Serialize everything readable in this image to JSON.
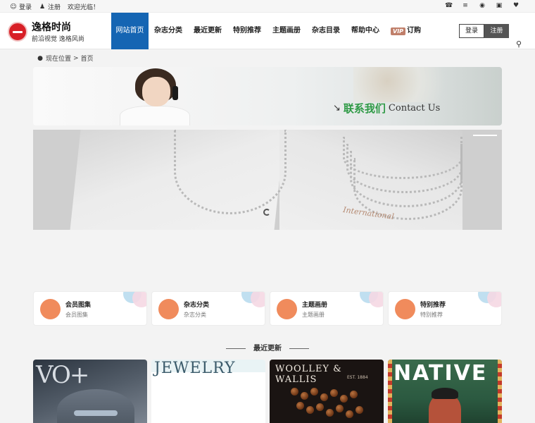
{
  "topbar": {
    "login": "登录",
    "register": "注册",
    "welcome": "欢迎光临！",
    "icons": [
      "phone-icon",
      "list-icon",
      "eye-icon",
      "calendar-icon",
      "heart-icon"
    ]
  },
  "header": {
    "site_title": "逸格时尚",
    "tagline": "前沿视觉   逸格风尚",
    "nav": [
      {
        "label": "网站首页",
        "active": true
      },
      {
        "label": "杂志分类"
      },
      {
        "label": "最近更新"
      },
      {
        "label": "特别推荐"
      },
      {
        "label": "主题画册"
      },
      {
        "label": "杂志目录"
      },
      {
        "label": "帮助中心"
      }
    ],
    "vip_badge": "VIP",
    "vip_label": "订购",
    "login_button": "登录",
    "register_button": "注册"
  },
  "breadcrumb": {
    "location_label": "现在位置",
    "separator": ">",
    "current": "首页"
  },
  "contact_banner": {
    "cn": "联系我们",
    "en": "Contact Us"
  },
  "slider": {
    "script_text": "International"
  },
  "cards": [
    {
      "title": "会员图集",
      "subtitle": "会员图集"
    },
    {
      "title": "杂志分类",
      "subtitle": "杂志分类"
    },
    {
      "title": "主题画册",
      "subtitle": "主题画册"
    },
    {
      "title": "特别推荐",
      "subtitle": "特别推荐"
    }
  ],
  "section": {
    "title": "最近更新"
  },
  "magazines": [
    {
      "cover_title": "VO+"
    },
    {
      "cover_title": "JEWELRY"
    },
    {
      "cover_title": "WOOLLEY & WALLIS",
      "est": "EST. 1884"
    },
    {
      "cover_title": "NATIVE"
    }
  ],
  "colors": {
    "nav_active": "#1565b3",
    "accent_orange": "#f08b5c",
    "contact_green": "#2f9a46",
    "vip_badge": "#c07f6a"
  }
}
